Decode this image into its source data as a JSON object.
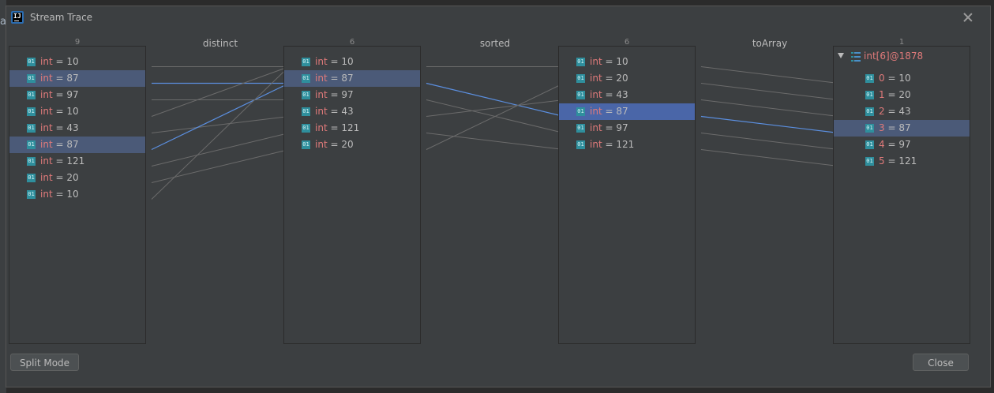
{
  "window": {
    "title": "Stream Trace"
  },
  "background": {
    "letter": "a"
  },
  "counts": [
    "9",
    "6",
    "6",
    "1"
  ],
  "operations": [
    "distinct",
    "sorted",
    "toArray"
  ],
  "columns": [
    {
      "items": [
        {
          "kw": "int",
          "val": "10"
        },
        {
          "kw": "int",
          "val": "87",
          "selected": true
        },
        {
          "kw": "int",
          "val": "97"
        },
        {
          "kw": "int",
          "val": "10"
        },
        {
          "kw": "int",
          "val": "43"
        },
        {
          "kw": "int",
          "val": "87",
          "selected": true
        },
        {
          "kw": "int",
          "val": "121"
        },
        {
          "kw": "int",
          "val": "20"
        },
        {
          "kw": "int",
          "val": "10"
        }
      ]
    },
    {
      "items": [
        {
          "kw": "int",
          "val": "10"
        },
        {
          "kw": "int",
          "val": "87",
          "selected": true
        },
        {
          "kw": "int",
          "val": "97"
        },
        {
          "kw": "int",
          "val": "43"
        },
        {
          "kw": "int",
          "val": "121"
        },
        {
          "kw": "int",
          "val": "20"
        }
      ]
    },
    {
      "items": [
        {
          "kw": "int",
          "val": "10"
        },
        {
          "kw": "int",
          "val": "20"
        },
        {
          "kw": "int",
          "val": "43"
        },
        {
          "kw": "int",
          "val": "87",
          "selected": true
        },
        {
          "kw": "int",
          "val": "97"
        },
        {
          "kw": "int",
          "val": "121"
        }
      ]
    }
  ],
  "result": {
    "label": "int[6]@1878",
    "items": [
      {
        "idx": "0",
        "val": "10"
      },
      {
        "idx": "1",
        "val": "20"
      },
      {
        "idx": "2",
        "val": "43"
      },
      {
        "idx": "3",
        "val": "87",
        "selected": true
      },
      {
        "idx": "4",
        "val": "97"
      },
      {
        "idx": "5",
        "val": "121"
      }
    ]
  },
  "badge_text": "01",
  "equals": "=",
  "links": [
    {
      "from_col": 0,
      "pairs": [
        [
          0,
          0
        ],
        [
          1,
          1
        ],
        [
          2,
          2
        ],
        [
          3,
          0
        ],
        [
          4,
          3
        ],
        [
          5,
          1
        ],
        [
          6,
          4
        ],
        [
          7,
          5
        ],
        [
          8,
          0
        ]
      ]
    },
    {
      "from_col": 1,
      "pairs": [
        [
          0,
          0
        ],
        [
          1,
          3
        ],
        [
          2,
          4
        ],
        [
          3,
          2
        ],
        [
          4,
          5
        ],
        [
          5,
          1
        ]
      ]
    },
    {
      "from_col": 2,
      "pairs": [
        [
          0,
          0
        ],
        [
          1,
          1
        ],
        [
          2,
          2
        ],
        [
          3,
          3
        ],
        [
          4,
          4
        ],
        [
          5,
          5
        ]
      ]
    }
  ],
  "buttons": {
    "split": "Split Mode",
    "close": "Close"
  },
  "colors": {
    "link": "#6b6b6b",
    "link_selected": "#5b8fe0",
    "keyword": "#e07a7a",
    "selection": "#4b5a78",
    "badge": "#2f8f9d"
  }
}
